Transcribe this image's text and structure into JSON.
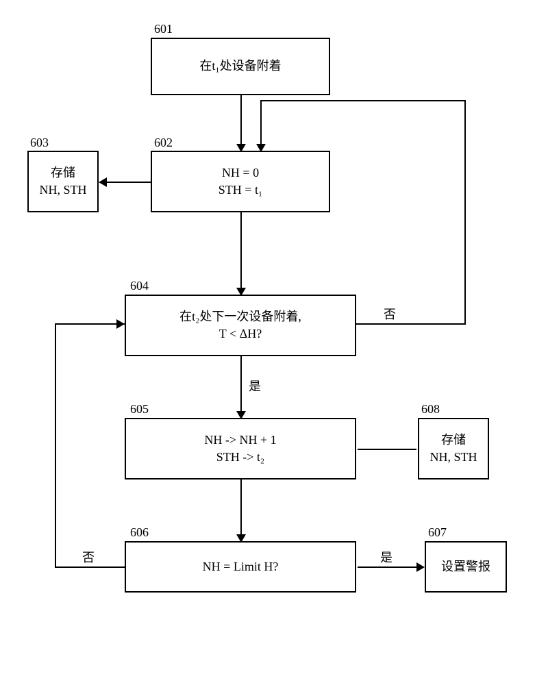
{
  "refs": {
    "b601": "601",
    "b602": "602",
    "b603": "603",
    "b604": "604",
    "b605": "605",
    "b606": "606",
    "b607": "607",
    "b608": "608"
  },
  "boxes": {
    "b601_l1": "在t₁处设备附着",
    "b602_l1": "NH = 0",
    "b602_l2": "STH = t₁",
    "b603_l1": "存储",
    "b603_l2": "NH, STH",
    "b604_l1": "在t₂处下一次设备附着,",
    "b604_l2": "T < ΔH?",
    "b605_l1": "NH -> NH + 1",
    "b605_l2": "STH -> t₂",
    "b606_l1": "NH = Limit H?",
    "b607_l1": "设置警报",
    "b608_l1": "存储",
    "b608_l2": "NH, STH"
  },
  "labels": {
    "yes": "是",
    "no": "否"
  }
}
